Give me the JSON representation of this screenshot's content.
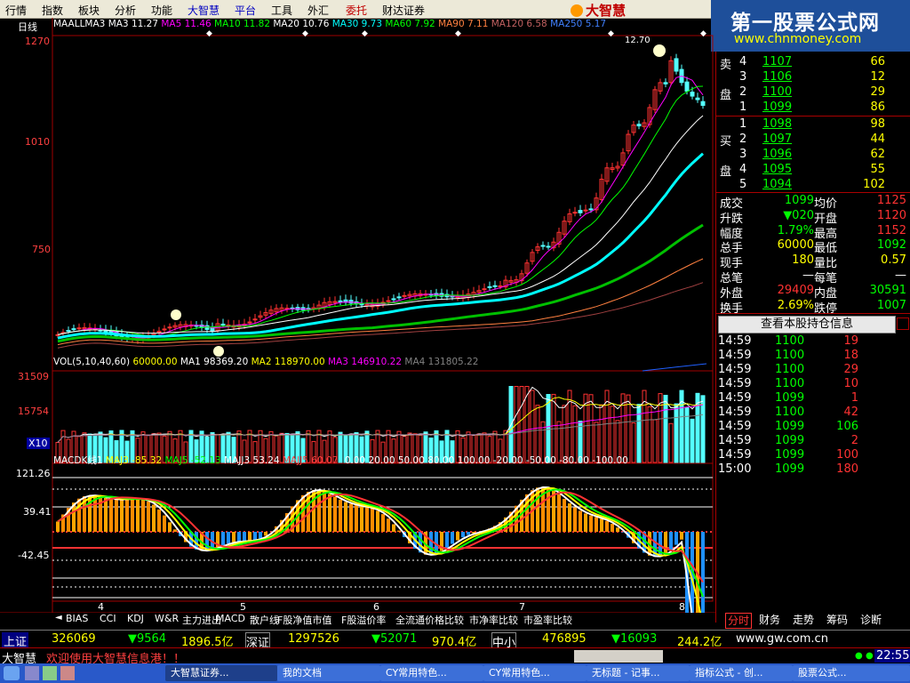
{
  "menu": {
    "items": [
      "行情",
      "指数",
      "板块",
      "分析",
      "功能",
      "大智慧",
      "平台",
      "工具",
      "外汇",
      "委托",
      "财达证券"
    ],
    "brand": "大智慧"
  },
  "site": {
    "title": "第一股票公式网",
    "url": "www.chnmoney.com"
  },
  "period": "日线",
  "ma_legend": {
    "label": "MAALLMA3",
    "ma3": "MA3 11.27",
    "ma5": "MA5 11.46",
    "ma10": "MA10 11.82",
    "ma20": "MA20 10.76",
    "ma30": "MA30 9.73",
    "ma60": "MA60 7.92",
    "ma90": "MA90 7.11",
    "ma120": "MA120 6.58",
    "ma250": "MA250 5.17"
  },
  "price_axis": {
    "top": "1270",
    "mid": "1010",
    "low": "750"
  },
  "peak_label": "12.70",
  "vol_legend": {
    "label": "VOL(5,10,40,60)",
    "v1": "60000.00",
    "ma1": "MA1 98369.20",
    "ma2": "MA2 118970.00",
    "ma3": "MA3 146910.22",
    "ma4": "MA4 131805.22"
  },
  "vol_axis": {
    "top": "31509",
    "mid": "15754",
    "unit": "X10"
  },
  "macd_legend": {
    "label": "MACDK线1",
    "majj3": "MAJ3 -85.32",
    "maj5": "MAJ5 -52.13",
    "majj3b": "MAJJ3 53.24",
    "majj5": "MAJJ5 60.07",
    "levels": "0.00  20.00  50.00  80.00  100.00  -20.00  -50.00  -80.00  -100.00"
  },
  "macd_axis": {
    "top": "121.26",
    "mid": "39.41",
    "low": "-42.45"
  },
  "x_axis": {
    "labels": [
      "4",
      "5",
      "6",
      "7",
      "8"
    ]
  },
  "ask": [
    {
      "lvl": "5",
      "price": "",
      "vol": ""
    },
    {
      "lvl": "4",
      "price": "1107",
      "vol": "66"
    },
    {
      "lvl": "3",
      "price": "1106",
      "vol": "12"
    },
    {
      "lvl": "2",
      "price": "1100",
      "vol": "29"
    },
    {
      "lvl": "1",
      "price": "1099",
      "vol": "86"
    }
  ],
  "bid": [
    {
      "lvl": "1",
      "price": "1098",
      "vol": "98"
    },
    {
      "lvl": "2",
      "price": "1097",
      "vol": "44"
    },
    {
      "lvl": "3",
      "price": "1096",
      "vol": "62"
    },
    {
      "lvl": "4",
      "price": "1095",
      "vol": "55"
    },
    {
      "lvl": "5",
      "price": "1094",
      "vol": "102"
    }
  ],
  "ask_label": [
    "卖",
    "盘"
  ],
  "bid_label": [
    "买",
    "盘"
  ],
  "stats": [
    {
      "k1": "成交",
      "v1": "1099",
      "k2": "均价",
      "v2": "1125"
    },
    {
      "k1": "升跌",
      "v1": "▼020",
      "k2": "开盘",
      "v2": "1120"
    },
    {
      "k1": "幅度",
      "v1": "1.79%",
      "k2": "最高",
      "v2": "1152"
    },
    {
      "k1": "总手",
      "v1": "60000",
      "k2": "最低",
      "v2": "1092"
    },
    {
      "k1": "现手",
      "v1": "180",
      "k2": "量比",
      "v2": "0.57"
    },
    {
      "k1": "总笔",
      "v1": "—",
      "k2": "每笔",
      "v2": "—"
    },
    {
      "k1": "外盘",
      "v1": "29409",
      "k2": "内盘",
      "v2": "30591"
    },
    {
      "k1": "换手",
      "v1": "2.69%",
      "k2": "跌停",
      "v2": "1007"
    }
  ],
  "holding_button": "查看本股持仓信息",
  "ticks": [
    {
      "t": "14:59",
      "p": "1100",
      "v": "19"
    },
    {
      "t": "14:59",
      "p": "1100",
      "v": "18"
    },
    {
      "t": "14:59",
      "p": "1100",
      "v": "29"
    },
    {
      "t": "14:59",
      "p": "1100",
      "v": "10"
    },
    {
      "t": "14:59",
      "p": "1099",
      "v": "1"
    },
    {
      "t": "14:59",
      "p": "1100",
      "v": "42"
    },
    {
      "t": "14:59",
      "p": "1099",
      "v": "106"
    },
    {
      "t": "14:59",
      "p": "1099",
      "v": "2"
    },
    {
      "t": "14:59",
      "p": "1099",
      "v": "100"
    },
    {
      "t": "15:00",
      "p": "1099",
      "v": "180"
    }
  ],
  "bottom_tabs": [
    "BIAS",
    "CCI",
    "KDJ",
    "W&R",
    "主力进出",
    "MACD",
    "散户线",
    "F股净值市值",
    "F股溢价率",
    "全流通价格比较",
    "市净率比较",
    "市盈率比较"
  ],
  "right_tabs": [
    "分时",
    "财务",
    "走势",
    "筹码",
    "诊断"
  ],
  "index_bar": {
    "sh_label": "上证",
    "sh_vol": "326069",
    "sh_chg": "▼9564",
    "sh_amt": "1896.5亿",
    "sz_label": "深证",
    "sz_vol": "1297526",
    "sz_chg": "▼52071",
    "sz_amt": "970.4亿",
    "zx_label": "中小",
    "zx_vol": "476895",
    "zx_chg": "▼16093",
    "zx_amt": "244.2亿",
    "site": "www.gw.com.cn"
  },
  "message": {
    "app": "大智慧",
    "text": "欢迎使用大智慧信息港！！",
    "time": "22:55"
  },
  "taskbar": [
    "大智慧证券...",
    "我的文档",
    "CY常用特色...",
    "CY常用特色...",
    "无标题 - 记事...",
    "指标公式 - 创...",
    "股票公式..."
  ],
  "colors": {
    "up": "#ff3232",
    "down": "#54ffff",
    "ma5": "#ff00ff",
    "ma10": "#00ff00",
    "ma20": "#ffffff",
    "ma30": "#00ffff",
    "ma60": "#00c000",
    "ma90": "#ff8040",
    "ma120": "#a04040",
    "ma250": "#2060ff"
  }
}
